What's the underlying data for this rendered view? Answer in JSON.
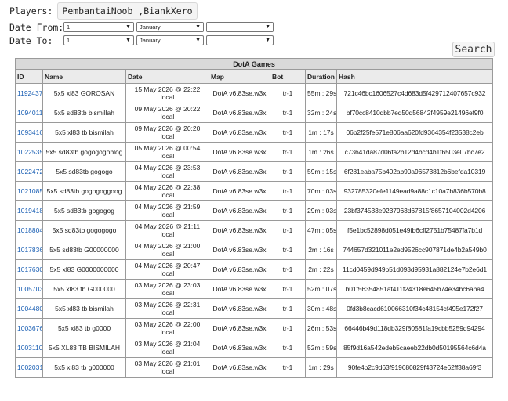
{
  "filters": {
    "players_label": "Players:",
    "players_value": "PembantaiNoob ,BiankXero",
    "date_from_label": "Date From:",
    "date_to_label": "Date To:",
    "date_from": {
      "day": "1",
      "month": "January",
      "year": ""
    },
    "date_to": {
      "day": "1",
      "month": "January",
      "year": ""
    },
    "search_label": "Search"
  },
  "table": {
    "caption": "DotA Games",
    "columns": [
      "ID",
      "Name",
      "Date",
      "Map",
      "Bot",
      "Duration",
      "Hash"
    ],
    "rows": [
      {
        "id": "1192437",
        "name": "5x5 xl83 GOROSAN",
        "date": "15 May 2026 @ 22:22 local",
        "map": "DotA v6.83se.w3x",
        "bot": "tr-1",
        "duration": "55m : 29s",
        "hash": "721c46bc1606527c4d683d5f429712407657c932"
      },
      {
        "id": "1094011",
        "name": "5x5 sd83tb bismillah",
        "date": "09 May 2026 @ 20:22 local",
        "map": "DotA v6.83se.w3x",
        "bot": "tr-1",
        "duration": "32m : 24s",
        "hash": "bf70cc8410dbb7ed50d56842f4959e21496ef9f0"
      },
      {
        "id": "1093416",
        "name": "5x5 xl83 tb bismilah",
        "date": "09 May 2026 @ 20:20 local",
        "map": "DotA v6.83se.w3x",
        "bot": "tr-1",
        "duration": "1m : 17s",
        "hash": "06b2f25fe571e806aa620fd9364354f23538c2eb"
      },
      {
        "id": "1022535",
        "name": "5x5 sd83tb gogogogoblog",
        "date": "05 May 2026 @ 00:54 local",
        "map": "DotA v6.83se.w3x",
        "bot": "tr-1",
        "duration": "1m : 26s",
        "hash": "c73641da87d06fa2b12d4bcd4b1f6503e07bc7e2"
      },
      {
        "id": "1022472",
        "name": "5x5 sd83tb gogogo",
        "date": "04 May 2026 @ 23:53 local",
        "map": "DotA v6.83se.w3x",
        "bot": "tr-1",
        "duration": "59m : 15s",
        "hash": "6f281eaba75b402ab90a96573812b6befda10319"
      },
      {
        "id": "1021085",
        "name": "5x5 sd83tb gogogoggoog",
        "date": "04 May 2026 @ 22:38 local",
        "map": "DotA v6.83se.w3x",
        "bot": "tr-1",
        "duration": "70m : 03s",
        "hash": "932785320efe1149ead9a88c1c10a7b836b570b8"
      },
      {
        "id": "1019418",
        "name": "5x5 sd83tb gogogog",
        "date": "04 May 2026 @ 21:59 local",
        "map": "DotA v6.83se.w3x",
        "bot": "tr-1",
        "duration": "29m : 03s",
        "hash": "23bf374533e9237963d67815f8657104002d4206"
      },
      {
        "id": "1018804",
        "name": "5x5 sd83tb gogogogo",
        "date": "04 May 2026 @ 21:11 local",
        "map": "DotA v6.83se.w3x",
        "bot": "tr-1",
        "duration": "47m : 05s",
        "hash": "f5e1bc52898d051e49fb6cff2751b75487fa7b1d"
      },
      {
        "id": "1017836",
        "name": "5x5 sd83tb G00000000",
        "date": "04 May 2026 @ 21:00 local",
        "map": "DotA v6.83se.w3x",
        "bot": "tr-1",
        "duration": "2m : 16s",
        "hash": "744657d321011e2ed9526cc907871de4b2a549b0"
      },
      {
        "id": "1017630",
        "name": "5x5 xl83 G0000000000",
        "date": "04 May 2026 @ 20:47 local",
        "map": "DotA v6.83se.w3x",
        "bot": "tr-1",
        "duration": "2m : 22s",
        "hash": "11cd0459d949b51d093d95931a882124e7b2e6d1"
      },
      {
        "id": "1005703",
        "name": "5x5 xl83 tb G000000",
        "date": "03 May 2026 @ 23:03 local",
        "map": "DotA v6.83se.w3x",
        "bot": "tr-1",
        "duration": "52m : 07s",
        "hash": "b01f56354851af411f24318e645b74e34bc6aba4"
      },
      {
        "id": "1004480",
        "name": "5x5 xl83 tb bismilah",
        "date": "03 May 2026 @ 22:31 local",
        "map": "DotA v6.83se.w3x",
        "bot": "tr-1",
        "duration": "30m : 48s",
        "hash": "0fd3b8cacd610066310f34c48154cf495e172f27"
      },
      {
        "id": "1003676",
        "name": "5x5 xl83 tb g0000",
        "date": "03 May 2026 @ 22:00 local",
        "map": "DotA v6.83se.w3x",
        "bot": "tr-1",
        "duration": "26m : 53s",
        "hash": "66446b49d118db329f80581fa19cbb5259d94294"
      },
      {
        "id": "1003110",
        "name": "5x5 XL83 TB BISMILAH",
        "date": "03 May 2026 @ 21:04 local",
        "map": "DotA v6.83se.w3x",
        "bot": "tr-1",
        "duration": "52m : 59s",
        "hash": "85f9d16a542edeb5caeeb22db0d50195564c6d4a"
      },
      {
        "id": "1002031",
        "name": "5x5 xl83 tb g000000",
        "date": "03 May 2026 @ 21:01 local",
        "map": "DotA v6.83se.w3x",
        "bot": "tr-1",
        "duration": "1m : 29s",
        "hash": "90fe4b2c9d63f919680829f43724e62ff38a69f3"
      }
    ]
  }
}
